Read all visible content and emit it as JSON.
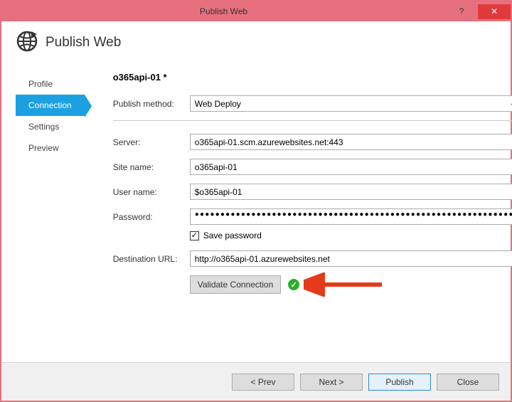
{
  "titlebar": {
    "title": "Publish Web"
  },
  "header": {
    "title": "Publish Web"
  },
  "sidebar": {
    "items": [
      {
        "label": "Profile"
      },
      {
        "label": "Connection"
      },
      {
        "label": "Settings"
      },
      {
        "label": "Preview"
      }
    ]
  },
  "main": {
    "profile_name": "o365api-01 *",
    "publish_method_label": "Publish method:",
    "publish_method_value": "Web Deploy",
    "fields": {
      "server": {
        "label": "Server:",
        "value": "o365api-01.scm.azurewebsites.net:443"
      },
      "site_name": {
        "label": "Site name:",
        "value": "o365api-01"
      },
      "user_name": {
        "label": "User name:",
        "value": "$o365api-01"
      },
      "password": {
        "label": "Password:",
        "value": "●●●●●●●●●●●●●●●●●●●●●●●●●●●●●●●●●●●●●●●●●●●●●●●●●●●●●●●●●●●●●●"
      },
      "save_password": {
        "label": "Save password",
        "checked": true
      },
      "destination": {
        "label": "Destination URL:",
        "value": "http://o365api-01.azurewebsites.net"
      }
    },
    "validate_button": "Validate Connection"
  },
  "footer": {
    "prev": "< Prev",
    "next": "Next >",
    "publish": "Publish",
    "close": "Close"
  }
}
